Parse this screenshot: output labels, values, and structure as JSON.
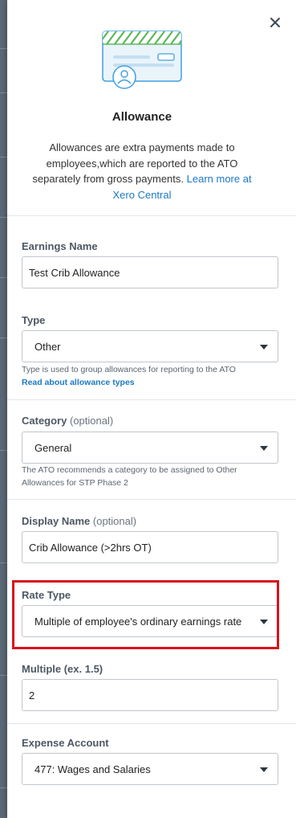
{
  "panel": {
    "title": "Allowance",
    "description": "Allowances are extra payments made to employees,which are reported to the ATO separately from gross payments.",
    "learn_more_link": "Learn more at Xero Central"
  },
  "icons": {
    "close": "close-icon",
    "illustration": "allowance-card-illustration",
    "dropdown": "chevron-down-icon"
  },
  "fields": {
    "earnings_name": {
      "label": "Earnings Name",
      "value": "Test Crib Allowance"
    },
    "type": {
      "label": "Type",
      "value": "Other",
      "help": "Type is used to group allowances for reporting to the ATO",
      "help_link": "Read about allowance types"
    },
    "category": {
      "label": "Category",
      "optional": "(optional)",
      "value": "General",
      "help": "The ATO recommends a category to be assigned to Other Allowances for STP Phase 2"
    },
    "display_name": {
      "label": "Display Name",
      "optional": "(optional)",
      "value": "Crib Allowance (>2hrs OT)"
    },
    "rate_type": {
      "label": "Rate Type",
      "value": "Multiple of employee's ordinary earnings rate"
    },
    "multiple": {
      "label": "Multiple (ex. 1.5)",
      "value": "2"
    },
    "expense_account": {
      "label": "Expense Account",
      "value": "477: Wages and Salaries"
    }
  },
  "colors": {
    "link": "#1d79c4",
    "highlight": "#d9131c",
    "illustration_green": "#5cb85c",
    "illustration_blue": "#3fa0e0"
  }
}
